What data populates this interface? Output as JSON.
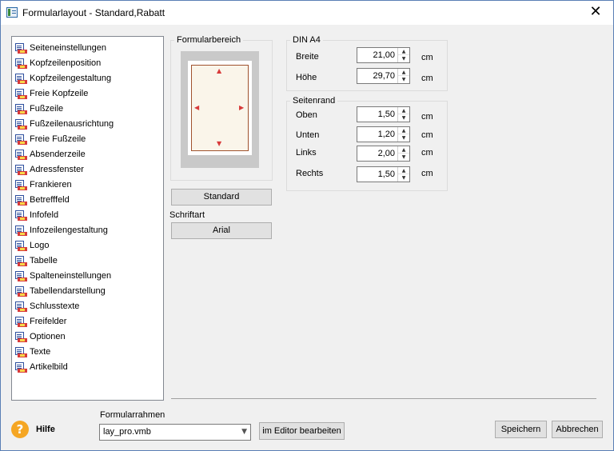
{
  "window": {
    "title": "Formularlayout - Standard,Rabatt",
    "close_glyph": "✕"
  },
  "nav": {
    "items": [
      {
        "label": "Seiteneinstellungen"
      },
      {
        "label": "Kopfzeilenposition"
      },
      {
        "label": "Kopfzeilengestaltung"
      },
      {
        "label": "Freie Kopfzeile"
      },
      {
        "label": "Fußzeile"
      },
      {
        "label": "Fußzeilenausrichtung"
      },
      {
        "label": "Freie Fußzeile"
      },
      {
        "label": "Absenderzeile"
      },
      {
        "label": "Adressfenster"
      },
      {
        "label": "Frankieren"
      },
      {
        "label": "Betrefffeld"
      },
      {
        "label": "Infofeld"
      },
      {
        "label": "Infozeilengestaltung"
      },
      {
        "label": "Logo"
      },
      {
        "label": "Tabelle"
      },
      {
        "label": "Spalteneinstellungen"
      },
      {
        "label": "Tabellendarstellung"
      },
      {
        "label": "Schlusstexte"
      },
      {
        "label": "Freifelder"
      },
      {
        "label": "Optionen"
      },
      {
        "label": "Texte"
      },
      {
        "label": "Artikelbild"
      }
    ]
  },
  "formularbereich": {
    "legend": "Formularbereich",
    "standard_button": "Standard",
    "font_label": "Schriftart",
    "font_button": "Arial"
  },
  "din": {
    "legend": "DIN A4",
    "fields": [
      {
        "label": "Breite",
        "value": "21,00",
        "unit": "cm"
      },
      {
        "label": "Höhe",
        "value": "29,70",
        "unit": "cm"
      }
    ]
  },
  "seitenrand": {
    "legend": "Seitenrand",
    "fields": [
      {
        "label": "Oben",
        "value": "1,50",
        "unit": "cm"
      },
      {
        "label": "Unten",
        "value": "1,20",
        "unit": "cm"
      },
      {
        "label": "Links",
        "value": "2,00",
        "unit": "cm"
      },
      {
        "label": "Rechts",
        "value": "1,50",
        "unit": "cm"
      }
    ]
  },
  "footer": {
    "help_glyph": "?",
    "help_label": "Hilfe",
    "frame_label": "Formularrahmen",
    "frame_value": "lay_pro.vmb",
    "edit_button": "im Editor bearbeiten",
    "save_button": "Speichern",
    "cancel_button": "Abbrechen"
  }
}
